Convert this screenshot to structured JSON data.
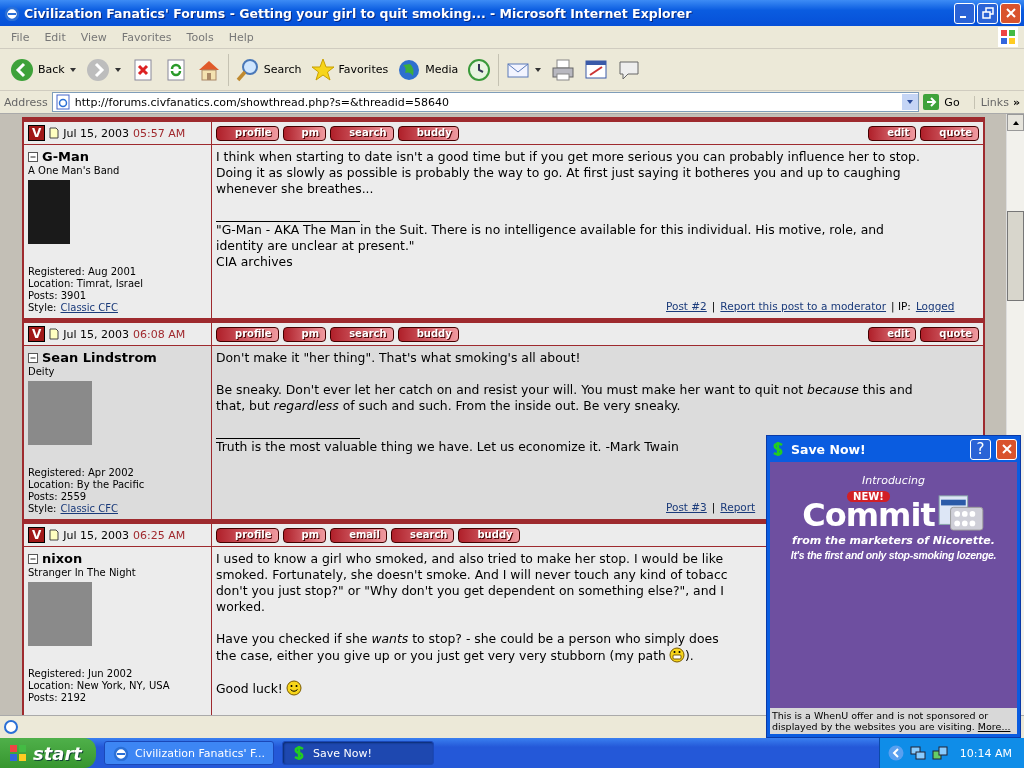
{
  "window": {
    "title": "Civilization Fanatics' Forums - Getting your girl to quit smoking... - Microsoft Internet Explorer"
  },
  "menu": [
    "File",
    "Edit",
    "View",
    "Favorites",
    "Tools",
    "Help"
  ],
  "toolbar": [
    {
      "kind": "back",
      "label": "Back",
      "dropdown": true
    },
    {
      "kind": "forward",
      "dropdown": true
    },
    {
      "kind": "stop"
    },
    {
      "kind": "refresh"
    },
    {
      "kind": "home"
    },
    {
      "kind": "search",
      "label": "Search"
    },
    {
      "kind": "favorites",
      "label": "Favorites"
    },
    {
      "kind": "media",
      "label": "Media"
    },
    {
      "kind": "history"
    },
    {
      "kind": "mail",
      "dropdown": true
    },
    {
      "kind": "print"
    },
    {
      "kind": "edit"
    },
    {
      "kind": "discuss"
    }
  ],
  "address": {
    "label": "Address",
    "url": "http://forums.civfanatics.com/showthread.php?s=&threadid=58640",
    "go": "Go",
    "links": "Links",
    "more": "»"
  },
  "posts": [
    {
      "badge": "V",
      "date": "Jul 15, 2003",
      "time": "05:57 AM",
      "buttons": [
        "profile",
        "pm",
        "search",
        "buddy"
      ],
      "actions": [
        "edit",
        "quote"
      ],
      "author": "G-Man",
      "rank": "A One Man's Band",
      "info": [
        "Registered: Aug 2001",
        "Location: Timrat, Israel",
        "Posts: 3901"
      ],
      "style_label": "Style:",
      "style_link": "Classic CFC",
      "paragraphs": [
        {
          "text": "I think when starting to date isn't a good time but if you get more serious you can probably influence her to stop.\nDoing it as slowly as possible is probably the way to go. At first just saying it botheres you and up to caughing\nwhenever she breathes..."
        }
      ],
      "signature": "\"G-Man - AKA The Man in the Suit. There is no intelligence available for this individual. His motive, role, and\nidentity are unclear at present.\"\nCIA archives",
      "footer": [
        {
          "kind": "link",
          "text": "Post #2"
        },
        {
          "kind": "text",
          "text": "|"
        },
        {
          "kind": "link",
          "text": "Report this post to a moderator"
        },
        {
          "kind": "text",
          "text": "| IP:"
        },
        {
          "kind": "link",
          "text": "Logged"
        }
      ]
    },
    {
      "badge": "V",
      "date": "Jul 15, 2003",
      "time": "06:08 AM",
      "buttons": [
        "profile",
        "pm",
        "search",
        "buddy"
      ],
      "actions": [
        "edit",
        "quote"
      ],
      "author": "Sean Lindstrom",
      "rank": "Deity",
      "info": [
        "Registered: Apr 2002",
        "Location: By the Pacific",
        "Posts: 2559"
      ],
      "style_label": "Style:",
      "style_link": "Classic CFC",
      "paragraphs": [
        {
          "text": "Don't make it \"her thing\". That's what smoking's all about!"
        },
        {
          "text": "Be sneaky. Don't ever let her catch on and resist your will. You must make her want to quit not *because* this and\nthat, but *regardless* of such and such. From the inside out. Be very sneaky."
        }
      ],
      "signature": "Truth is the most valuable thing we have. Let us economize it. -Mark Twain",
      "footer": [
        {
          "kind": "link",
          "text": "Post #3"
        },
        {
          "kind": "text",
          "text": "|"
        },
        {
          "kind": "link",
          "text": "Report"
        }
      ]
    },
    {
      "badge": "V",
      "date": "Jul 15, 2003",
      "time": "06:25 AM",
      "buttons": [
        "profile",
        "pm",
        "email",
        "search",
        "buddy"
      ],
      "author": "nixon",
      "rank": "Stranger In The Night",
      "info": [
        "Registered: Jun 2002",
        "Location: New York, NY, USA",
        "Posts: 2192"
      ],
      "paragraphs": [
        {
          "text": "I used to know a girl who smoked, and also tried to make her stop. I would be like\nsmoked. Fortunately, she doesn't smoke. And I will never touch any kind of tobacc\ndon't you just stop?\" or \"Why don't you get dependent on something else?\", and I\nworked."
        },
        {
          "text": "Have you checked if she *wants* to stop? - she could be a person who simply does",
          "line": "the case, either you give up or you just get very very stubborn (my path",
          "kind": "grin",
          "tail": ")."
        },
        {
          "text": "Good luck!",
          "kind": "smile"
        }
      ]
    }
  ],
  "popup": {
    "title": "Save Now!",
    "help": "?",
    "intro": "Introducing",
    "badge": "NEW!",
    "brand": "Commit",
    "line": "from the marketers of Nicorette.",
    "tagline": "It's the first and only stop-smoking lozenge.",
    "note": "This is a WhenU offer and is not sponsored or displayed by the websites you are visiting.",
    "more": "More..."
  },
  "taskbar": {
    "start": "start",
    "tasks": [
      {
        "kind": "browser",
        "label": "Civilization Fanatics' F...",
        "selected": false
      },
      {
        "kind": "dollar",
        "label": "Save Now!",
        "selected": true
      }
    ],
    "clock": "10:14 AM"
  }
}
